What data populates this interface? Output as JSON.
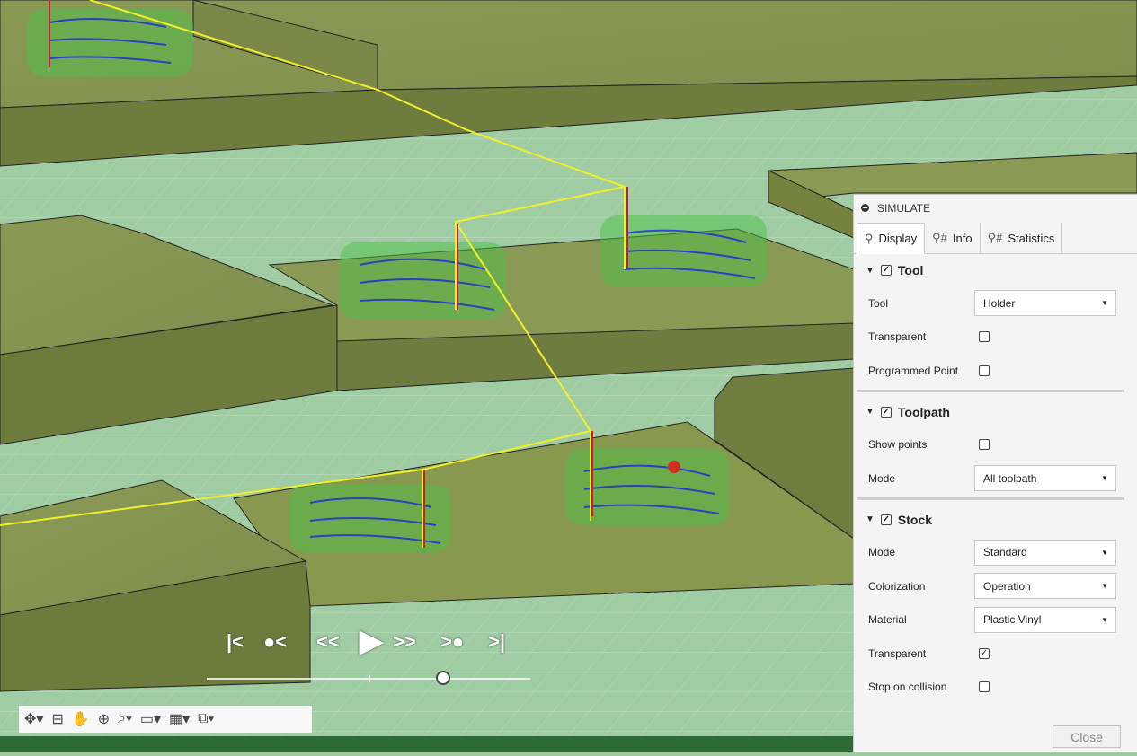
{
  "panel": {
    "title": "SIMULATE",
    "tabs": [
      {
        "label": "Display",
        "icon": "tool-icon"
      },
      {
        "label": "Info",
        "icon": "info-tool-icon"
      },
      {
        "label": "Statistics",
        "icon": "statistics-tool-icon"
      }
    ],
    "tool_section": {
      "title": "Tool",
      "checked": true,
      "tool_label": "Tool",
      "tool_value": "Holder",
      "transparent_label": "Transparent",
      "transparent_checked": false,
      "programmed_point_label": "Programmed Point",
      "programmed_point_checked": false
    },
    "toolpath_section": {
      "title": "Toolpath",
      "checked": true,
      "show_points_label": "Show points",
      "show_points_checked": false,
      "mode_label": "Mode",
      "mode_value": "All toolpath"
    },
    "stock_section": {
      "title": "Stock",
      "checked": true,
      "mode_label": "Mode",
      "mode_value": "Standard",
      "colorization_label": "Colorization",
      "colorization_value": "Operation",
      "material_label": "Material",
      "material_value": "Plastic Vinyl",
      "transparent_label": "Transparent",
      "transparent_checked": true,
      "stop_on_collision_label": "Stop on collision",
      "stop_on_collision_checked": false
    },
    "close_label": "Close"
  },
  "playback": {
    "slider_position": 0.73
  },
  "colors": {
    "stock": "#7f8f4c",
    "toolpath": "#1f2fd8",
    "rapid": "#f2ef2a",
    "pocket": "#4cc04a",
    "background": "#9cc9a0"
  }
}
